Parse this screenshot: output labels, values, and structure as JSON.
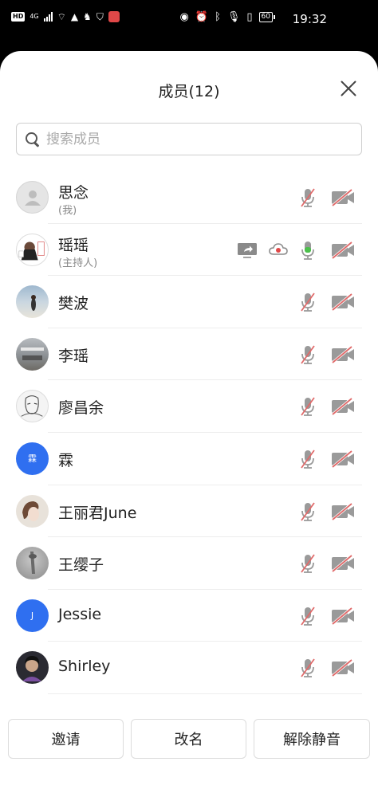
{
  "status_bar": {
    "hd": "HD",
    "network": "4G",
    "battery": "60",
    "time": "19:32"
  },
  "header": {
    "title": "成员(12)"
  },
  "search": {
    "placeholder": "搜索成员"
  },
  "members": [
    {
      "name": "思念",
      "sub": "(我)",
      "avatar": "default",
      "mic": "muted",
      "camera": "off"
    },
    {
      "name": "瑶瑶",
      "sub": "(主持人)",
      "avatar": "photo",
      "mic": "active",
      "camera": "off",
      "sharing": true,
      "recording": true
    },
    {
      "name": "樊波",
      "avatar": "photo",
      "mic": "muted",
      "camera": "off"
    },
    {
      "name": "李瑶",
      "avatar": "photo",
      "mic": "muted",
      "camera": "off"
    },
    {
      "name": "廖昌余",
      "avatar": "photo",
      "mic": "muted",
      "camera": "off"
    },
    {
      "name": "霖",
      "avatar_text": "霖",
      "avatar": "letter",
      "mic": "muted",
      "camera": "off"
    },
    {
      "name": "王丽君June",
      "avatar": "photo",
      "mic": "muted",
      "camera": "off"
    },
    {
      "name": "王缨子",
      "avatar": "photo",
      "mic": "muted",
      "camera": "off"
    },
    {
      "name": "Jessie",
      "avatar_text": "J",
      "avatar": "letter",
      "mic": "muted",
      "camera": "off"
    },
    {
      "name": "Shirley",
      "avatar": "photo",
      "mic": "muted",
      "camera": "off"
    }
  ],
  "actions": {
    "invite": "邀请",
    "rename": "改名",
    "unmute_all": "解除静音"
  },
  "colors": {
    "accent": "#2f6ff0",
    "mic_active": "#4cc04c",
    "muted_slash": "#e06a6a"
  }
}
